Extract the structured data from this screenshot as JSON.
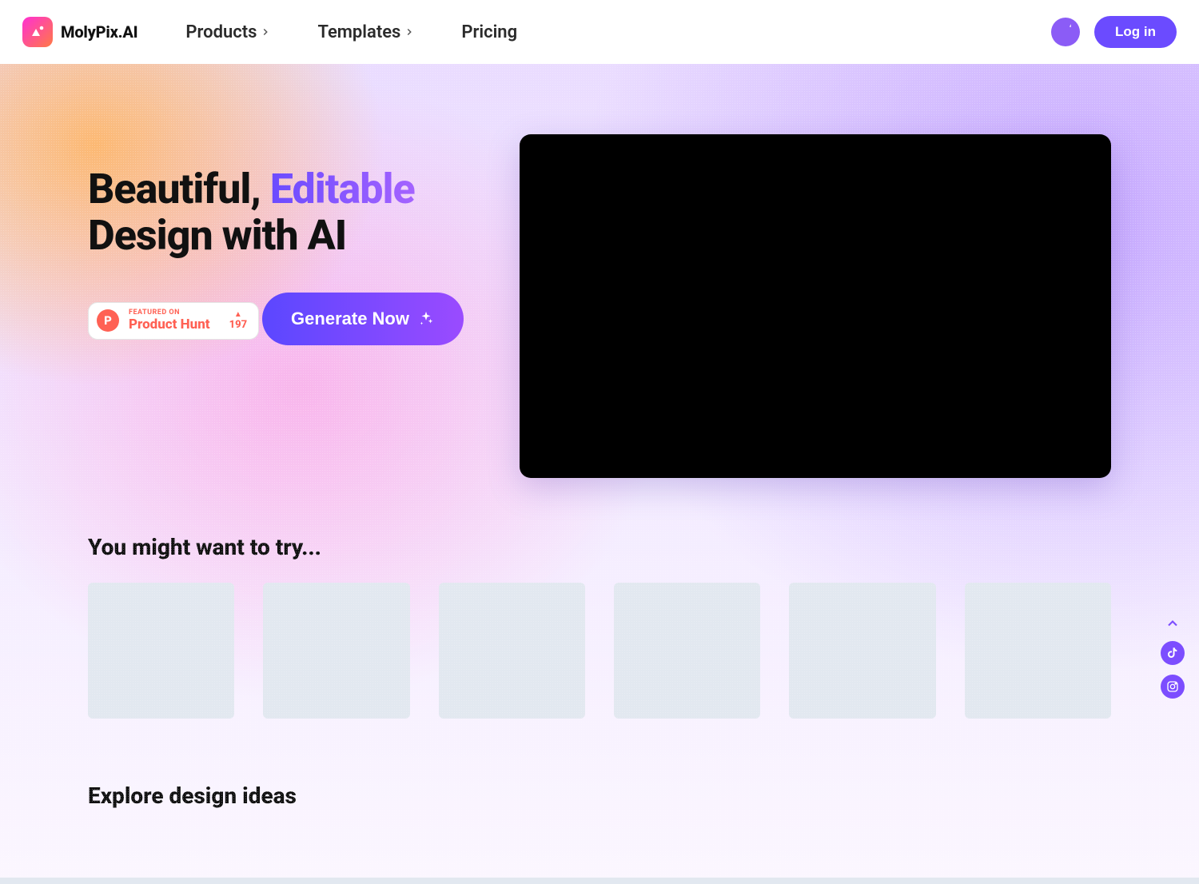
{
  "brand": {
    "name": "MolyPix.AI"
  },
  "nav": {
    "products": "Products",
    "templates": "Templates",
    "pricing": "Pricing",
    "login": "Log in"
  },
  "hero": {
    "title_pre": "Beautiful, ",
    "title_accent": "Editable",
    "title_post": "Design with AI",
    "product_hunt": {
      "featured_label": "FEATURED ON",
      "name": "Product Hunt",
      "votes": "197"
    },
    "cta": "Generate Now"
  },
  "sections": {
    "try_heading": "You might want to try...",
    "explore_heading": "Explore design ideas"
  }
}
